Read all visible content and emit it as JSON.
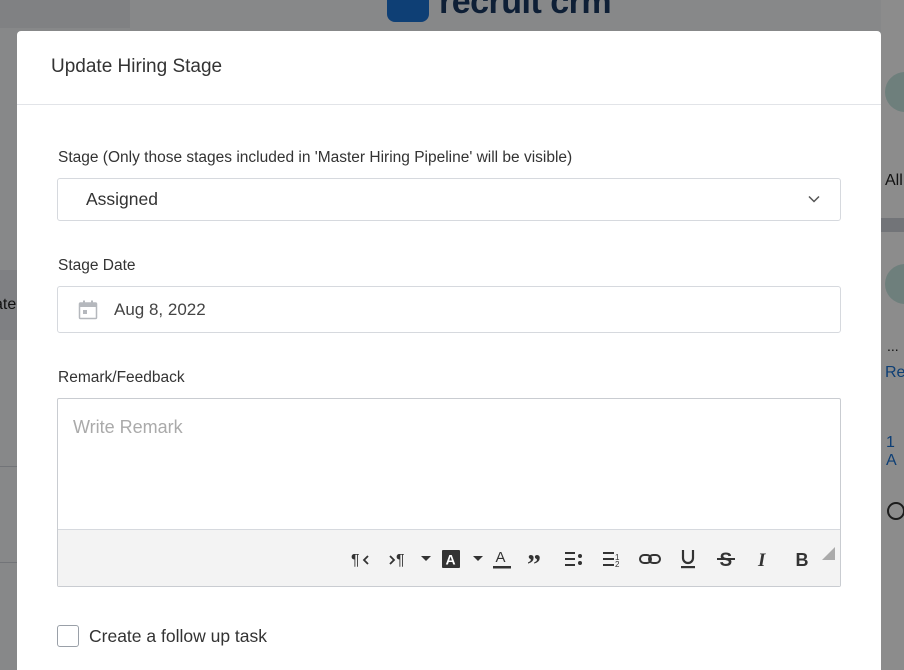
{
  "background": {
    "logo_text": "recruit crm",
    "left_text": "ate",
    "right": {
      "all_text": "All",
      "dots": "...",
      "re_text": "Re",
      "one_text": "1 A"
    }
  },
  "modal": {
    "title": "Update Hiring Stage",
    "stage": {
      "label": "Stage (Only those stages included in 'Master Hiring Pipeline' will be visible)",
      "value": "Assigned"
    },
    "stage_date": {
      "label": "Stage Date",
      "value": "Aug 8, 2022"
    },
    "remark": {
      "label": "Remark/Feedback",
      "placeholder": "Write Remark",
      "toolbar": [
        "rtl-paragraph-icon",
        "ltr-paragraph-icon",
        "dropdown-caret-icon",
        "background-color-icon",
        "dropdown-caret-icon",
        "text-color-icon",
        "blockquote-icon",
        "unordered-list-icon",
        "ordered-list-icon",
        "link-icon",
        "underline-icon",
        "strikethrough-icon",
        "italic-icon",
        "bold-icon"
      ]
    },
    "follow_up": {
      "label": "Create a follow up task",
      "checked": false
    }
  },
  "colors": {
    "brand": "#1b73d6",
    "overlay": "rgba(0,0,0,0.45)"
  }
}
